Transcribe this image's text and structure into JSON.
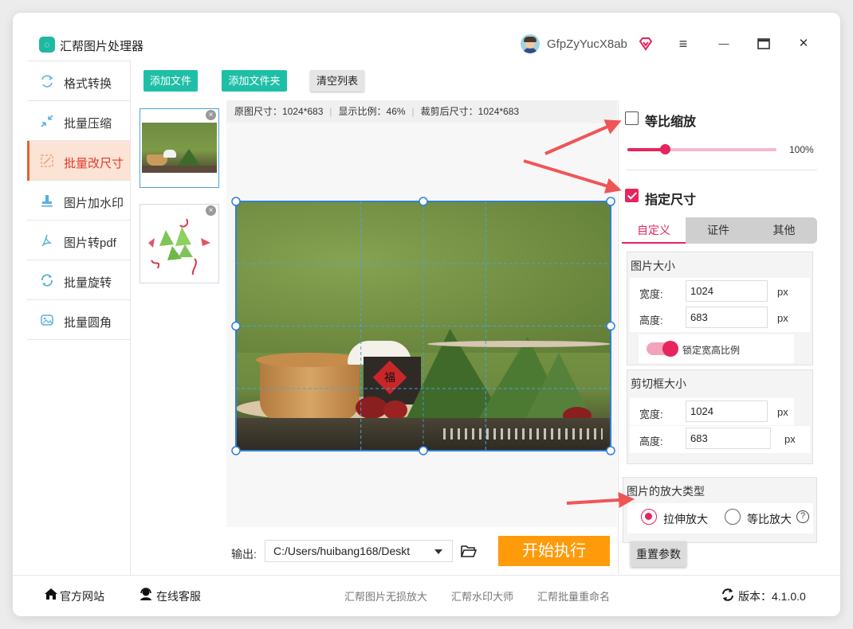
{
  "app": {
    "title": "汇帮图片处理器",
    "logo_glyph": "◌",
    "username": "GfpZyYucX8ab"
  },
  "window_controls": {
    "menu": "≡",
    "minimize": "—",
    "maximize": "□",
    "close": "✕"
  },
  "sidebar": {
    "items": [
      {
        "label": "格式转换",
        "icon": "convert-icon"
      },
      {
        "label": "批量压缩",
        "icon": "compress-icon"
      },
      {
        "label": "批量改尺寸",
        "icon": "resize-icon",
        "active": true
      },
      {
        "label": "图片加水印",
        "icon": "watermark-icon"
      },
      {
        "label": "图片转pdf",
        "icon": "pdf-icon"
      },
      {
        "label": "批量旋转",
        "icon": "rotate-icon"
      },
      {
        "label": "批量圆角",
        "icon": "round-corner-icon"
      }
    ]
  },
  "toolbar": {
    "add_file": "添加文件",
    "add_folder": "添加文件夹",
    "clear_list": "清空列表"
  },
  "thumbnails": {
    "close_glyph": "×",
    "count": 2
  },
  "preview": {
    "original_size": "原图尺寸：1024*683",
    "display_ratio": "显示比例：46%",
    "cropped_size": "裁剪后尺寸：1024*683",
    "photo_badge": "福"
  },
  "output": {
    "label": "输出:",
    "path": "C:/Users/huibang168/Deskt",
    "start": "开始执行"
  },
  "options": {
    "proportional_label": "等比缩放",
    "proportional_checked": false,
    "scale_value": "100%",
    "scale_fraction": 0.25,
    "specified_label": "指定尺寸",
    "specified_checked": true,
    "tabs": [
      "自定义",
      "证件",
      "其他"
    ],
    "active_tab": 0,
    "image_size": {
      "title": "图片大小",
      "width_label": "宽度:",
      "width": "1024",
      "height_label": "高度:",
      "height": "683",
      "unit": "px",
      "lock_label": "锁定宽高比例",
      "lock_on": true
    },
    "crop_size": {
      "title": "剪切框大小",
      "width_label": "宽度:",
      "width": "1024",
      "height_label": "高度:",
      "height": "683",
      "unit": "px"
    },
    "enlarge": {
      "title": "图片的放大类型",
      "stretch": "拉伸放大",
      "proportional": "等比放大",
      "selected": "stretch",
      "help_glyph": "?"
    },
    "reset": "重置参数"
  },
  "footer": {
    "website": "官方网站",
    "support": "在线客服",
    "links": [
      "汇帮图片无损放大",
      "汇帮水印大师",
      "汇帮批量重命名"
    ],
    "version": "版本：4.1.0.0"
  },
  "colors": {
    "accent": "#e6245d",
    "teal": "#1fbfa7",
    "orange": "#ff9a0a",
    "active_side_bg": "#fbe3d5",
    "annotation": "#f05555"
  }
}
